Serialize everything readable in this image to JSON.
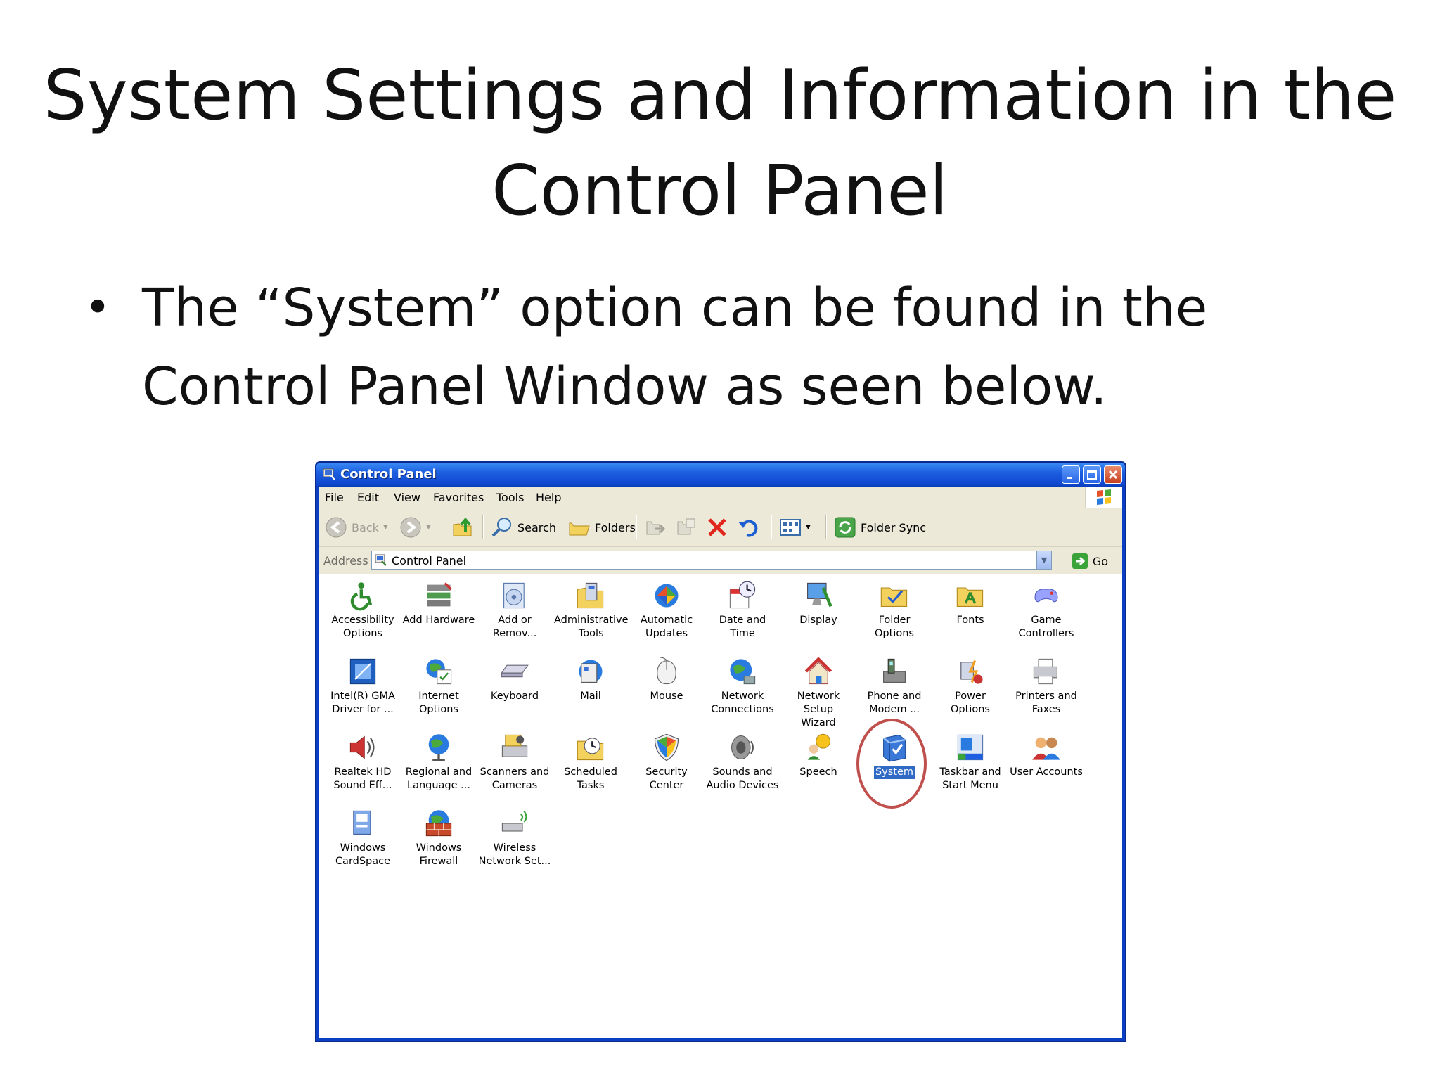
{
  "slide": {
    "title_line1": "System Settings and Information in the",
    "title_line2": "Control Panel",
    "bullet_line1": "The “System” option can be found in the",
    "bullet_line2": "Control Panel Window as seen below."
  },
  "window": {
    "title": "Control Panel",
    "menu": [
      "File",
      "Edit",
      "View",
      "Favorites",
      "Tools",
      "Help"
    ],
    "toolbar": {
      "back": "Back",
      "search": "Search",
      "folders": "Folders",
      "folder_sync": "Folder Sync"
    },
    "address": {
      "label": "Address",
      "value": "Control Panel",
      "go": "Go"
    },
    "items": [
      {
        "label": "Accessibility\nOptions",
        "icon": "accessibility-icon"
      },
      {
        "label": "Add Hardware",
        "icon": "add-hardware-icon"
      },
      {
        "label": "Add or\nRemov...",
        "icon": "add-remove-programs-icon"
      },
      {
        "label": "Administrative\nTools",
        "icon": "administrative-tools-icon"
      },
      {
        "label": "Automatic\nUpdates",
        "icon": "automatic-updates-icon"
      },
      {
        "label": "Date and Time",
        "icon": "date-time-icon"
      },
      {
        "label": "Display",
        "icon": "display-icon"
      },
      {
        "label": "Folder Options",
        "icon": "folder-options-icon"
      },
      {
        "label": "Fonts",
        "icon": "fonts-icon"
      },
      {
        "label": "Game\nControllers",
        "icon": "game-controllers-icon"
      },
      {
        "label": "Intel(R) GMA\nDriver for ...",
        "icon": "intel-gma-icon"
      },
      {
        "label": "Internet\nOptions",
        "icon": "internet-options-icon"
      },
      {
        "label": "Keyboard",
        "icon": "keyboard-icon"
      },
      {
        "label": "Mail",
        "icon": "mail-icon"
      },
      {
        "label": "Mouse",
        "icon": "mouse-icon"
      },
      {
        "label": "Network\nConnections",
        "icon": "network-connections-icon"
      },
      {
        "label": "Network Setup\nWizard",
        "icon": "network-setup-wizard-icon"
      },
      {
        "label": "Phone and\nModem ...",
        "icon": "phone-modem-icon"
      },
      {
        "label": "Power Options",
        "icon": "power-options-icon"
      },
      {
        "label": "Printers and\nFaxes",
        "icon": "printers-faxes-icon"
      },
      {
        "label": "Realtek HD\nSound Eff...",
        "icon": "realtek-sound-icon"
      },
      {
        "label": "Regional and\nLanguage ...",
        "icon": "regional-language-icon"
      },
      {
        "label": "Scanners and\nCameras",
        "icon": "scanners-cameras-icon"
      },
      {
        "label": "Scheduled\nTasks",
        "icon": "scheduled-tasks-icon"
      },
      {
        "label": "Security\nCenter",
        "icon": "security-center-icon"
      },
      {
        "label": "Sounds and\nAudio Devices",
        "icon": "sounds-audio-icon"
      },
      {
        "label": "Speech",
        "icon": "speech-icon"
      },
      {
        "label": "System",
        "icon": "system-icon",
        "selected": true
      },
      {
        "label": "Taskbar and\nStart Menu",
        "icon": "taskbar-start-menu-icon"
      },
      {
        "label": "User Accounts",
        "icon": "user-accounts-icon"
      },
      {
        "label": "Windows\nCardSpace",
        "icon": "windows-cardspace-icon"
      },
      {
        "label": "Windows\nFirewall",
        "icon": "windows-firewall-icon"
      },
      {
        "label": "Wireless\nNetwork Set...",
        "icon": "wireless-network-icon"
      }
    ]
  },
  "colors": {
    "titlebar": "#0f47cf",
    "selection": "#316ac5",
    "callout": "#c0504d",
    "close": "#c8401f"
  }
}
